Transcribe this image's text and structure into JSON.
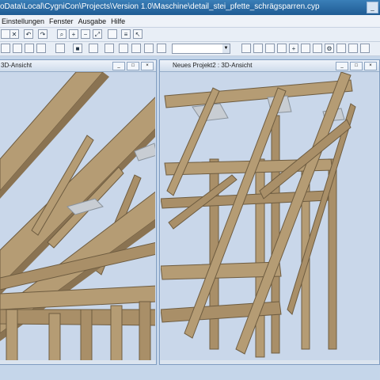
{
  "window": {
    "title": "oData\\Local\\CygniCon\\Projects\\Version 1.0\\Maschine\\detail_stei_pfette_schrägsparren.cyp"
  },
  "menu": [
    "Einstellungen",
    "Fenster",
    "Ausgabe",
    "Hilfe"
  ],
  "panes": [
    {
      "title": "3D-Ansicht"
    },
    {
      "title": "Neues Projekt2 : 3D-Ansicht"
    }
  ],
  "colors": {
    "wood": "#b59c74",
    "wood_dark": "#8a7352",
    "metal": "#c8cdd3",
    "view_bg": "#c9d7ea"
  }
}
